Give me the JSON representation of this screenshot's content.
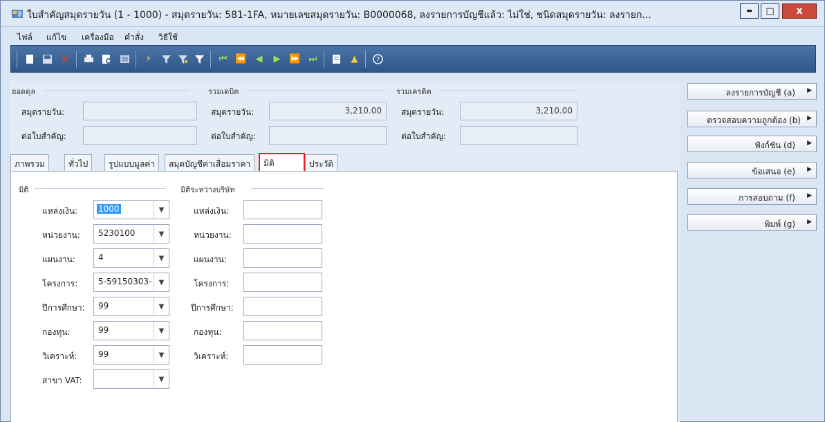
{
  "window": {
    "title": "ใบสำคัญสมุดรายวัน (1 - 1000) - สมุดรายวัน: 581-1FA, หมายเลขสมุดรายวัน: B0000068, ลงรายการบัญชีแล้ว: ไม่ใช่, ชนิดสมุดรายวัน: ลงรายก...",
    "minimize_label": "▬",
    "maximize_label": "□",
    "close_label": "x"
  },
  "menu": {
    "items": [
      "ไฟล์",
      "แก้ไข",
      "เครื่องมือ",
      "คำสั่ง",
      "วิธีใช้"
    ]
  },
  "toolbar": {
    "icons": [
      "new-icon",
      "save-icon",
      "delete-icon",
      "print-icon",
      "print-preview-icon",
      "export-icon",
      "filter-selection-icon",
      "advanced-filter-icon",
      "filter-by-field-icon",
      "filter-icon",
      "first-record-icon",
      "previous-page-icon",
      "previous-record-icon",
      "next-record-icon",
      "next-page-icon",
      "last-record-icon",
      "attachment-icon",
      "alert-icon",
      "help-icon"
    ]
  },
  "balance": {
    "group1": "ยอดดุล",
    "group2": "รวมเดบิต",
    "group3": "รวมเครดิต",
    "journal_label": "สมุดรายวัน:",
    "voucher_label": "ต่อใบสำคัญ:",
    "journal_label2": "สมุดรายวัน:",
    "voucher_label2": "ต่อใบสำคัญ:",
    "journal_label3": "สมุดรายวัน:",
    "voucher_label3": "ต่อใบสำคัญ:",
    "balance_journal": "",
    "balance_voucher": "",
    "debit_journal": "3,210.00",
    "debit_voucher": "",
    "credit_journal": "3,210.00",
    "credit_voucher": ""
  },
  "tabs": [
    "ภาพรวม",
    "ทั่วไป",
    "รูปแบบมูลค่า",
    "สมุดบัญชีค่าเสื่อมราคา",
    "มิติ",
    "ประวัติ"
  ],
  "active_tab": "มิติ",
  "dimensions": {
    "group_title": "มิติ",
    "intercompany_title": "มิติระหว่างบริษัท",
    "fields": [
      {
        "label": "แหล่งเงิน:",
        "value": "1000"
      },
      {
        "label": "หน่วยงาน:",
        "value": "5230100"
      },
      {
        "label": "แผนงาน:",
        "value": "4"
      },
      {
        "label": "โครงการ:",
        "value": "5-59150303-"
      },
      {
        "label": "ปีการศึกษา:",
        "value": "99"
      },
      {
        "label": "กองทุน:",
        "value": "99"
      },
      {
        "label": "วิเคราะห์:",
        "value": "99"
      },
      {
        "label": "สาขา VAT:",
        "value": ""
      }
    ],
    "intercompany_fields": [
      "แหล่งเงิน:",
      "หน่วยงาน:",
      "แผนงาน:",
      "โครงการ:",
      "ปีการศึกษา:",
      "กองทุน:",
      "วิเคราะห์:"
    ]
  },
  "actions": [
    "ลงรายการบัญชี (a)",
    "ตรวจสอบความถูกต้อง (b)",
    "ฟังก์ชัน (d)",
    "ข้อเสนอ (e)",
    "การสอบถาม (f)",
    "พิมพ์ (g)"
  ],
  "colors": {
    "toolbar": "#2f5688",
    "active_tab_highlight": "#e02020",
    "selection": "#3399ff"
  }
}
